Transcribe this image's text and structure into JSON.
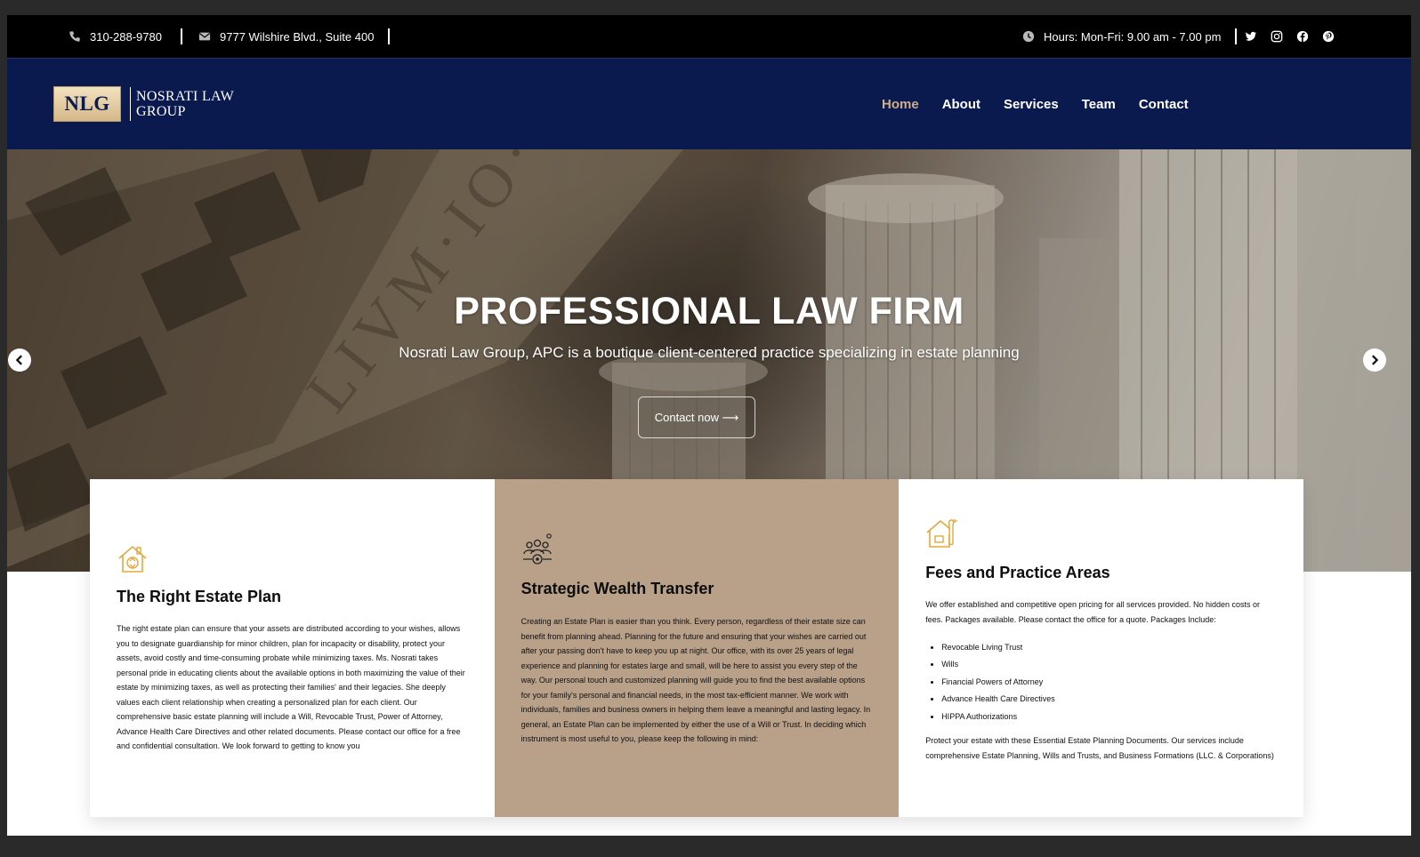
{
  "topbar": {
    "phone": "310-288-9780",
    "address": "9777 Wilshire Blvd., Suite 400",
    "hours": "Hours: Mon-Fri: 9.00 am - 7.00 pm",
    "social": [
      "twitter-icon",
      "instagram-icon",
      "facebook-icon",
      "pinterest-icon"
    ]
  },
  "nav": {
    "logo_badge": "NLG",
    "logo_line1": "NOSRATI LAW",
    "logo_line2": "GROUP",
    "items": [
      "Home",
      "About",
      "Services",
      "Team",
      "Contact"
    ],
    "active": "Home"
  },
  "hero": {
    "title": "PROFESSIONAL LAW FIRM",
    "subtitle": "Nosrati Law Group, APC is a boutique client-centered practice specializing in estate planning",
    "button": "Contact now ⟶"
  },
  "cards": [
    {
      "icon": "house-recycle-icon",
      "title": "The Right Estate Plan",
      "body": "The right estate plan can ensure that your assets are distributed according to your wishes, allows you to designate guardianship for minor children, plan for incapacity or disability, protect your assets, avoid costly and time-consuming probate while minimizing taxes. Ms. Nosrati takes personal pride in educating clients about the available options in both maximizing the value of their estate by minimizing taxes, as well as protecting their families' and their legacies. She deeply values each client relationship when creating a personalized plan for each client. Our comprehensive basic estate planning will include a Will, Revocable Trust, Power of Attorney, Advance Health Care Directives and other related documents. Please contact our office for a free and confidential consultation. We look forward to getting to know you"
    },
    {
      "icon": "people-gear-icon",
      "title": "Strategic Wealth Transfer",
      "body": "Creating an Estate Plan is easier than you think. Every person, regardless of their estate size can benefit from planning ahead.   Planning for the future and ensuring that your wishes are carried out after your passing don't have to keep you up at night. Our office, with its over 25 years of legal experience and planning for estates large and small, will be here to assist you every step of the way. Our personal touch and customized planning will guide you to find the best available options for your family's personal and financial needs, in the most tax-efficient manner.   We work with individuals, families and business owners in helping them leave a meaningful and lasting legacy. In general, an Estate Plan can be implemented by either the use of a Will or Trust. In deciding which instrument is most useful to you, please keep the following in mind:"
    },
    {
      "icon": "house-wrench-icon",
      "title": "Fees and Practice Areas",
      "intro": "We offer established and competitive open pricing for all services provided. No hidden costs or fees. Packages available. Please contact the office for a quote. Packages Include:",
      "list": [
        "Revocable Living Trust",
        "Wills",
        "Financial Powers of Attorney",
        "Advance Health Care Directives",
        "HIPPA Authorizations"
      ],
      "outro": "Protect your estate with these Essential Estate Planning Documents. Our services include comprehensive Estate Planning, Wills and Trusts, and Business Formations (LLC. & Corporations)"
    }
  ],
  "colors": {
    "topbar": "#000000",
    "nav": "#0b1a4e",
    "accent": "#c9ae8f",
    "card_tan": "#b8a089",
    "icon_gold": "#e3a83b"
  }
}
